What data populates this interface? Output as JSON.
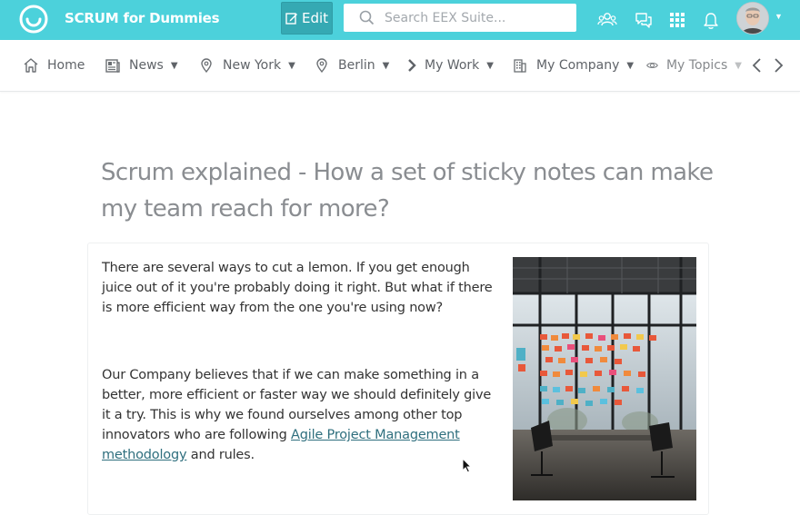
{
  "topbar": {
    "app_title": "SCRUM for Dummies",
    "edit_label": "Edit",
    "search_placeholder": "Search EEX Suite...",
    "icons": [
      "community-icon",
      "chat-icon",
      "apps-grid-icon",
      "bell-icon"
    ],
    "accent_color": "#4cd1db"
  },
  "nav": {
    "items": [
      {
        "label": "Home",
        "icon": "home-icon"
      },
      {
        "label": "News",
        "icon": "news-icon",
        "dropdown": true
      },
      {
        "label": "New York",
        "icon": "location-pin-icon",
        "dropdown": true
      },
      {
        "label": "Berlin",
        "icon": "location-pin-icon",
        "dropdown": true
      },
      {
        "label": "My Work",
        "icon": "chevron-right-icon",
        "dropdown": true
      },
      {
        "label": "My Company",
        "icon": "building-icon",
        "dropdown": true
      },
      {
        "label": "My Topics",
        "icon": "eye-icon",
        "dropdown": true
      }
    ]
  },
  "article": {
    "title": "Scrum explained - How a set of sticky notes can make my team reach for more?",
    "paragraph1": "There are several ways to cut a lemon. If you get enough juice out of it you're probably doing it right. But what if there is more efficient way from the one you're using now?",
    "paragraph2_before": "Our Company believes that if we can make something in a better, more efficient or faster way we should definitely give it a try. This is why we found ourselves among other top innovators who are following ",
    "paragraph2_link": "Agile Project Management methodology",
    "paragraph2_after": " and rules."
  }
}
